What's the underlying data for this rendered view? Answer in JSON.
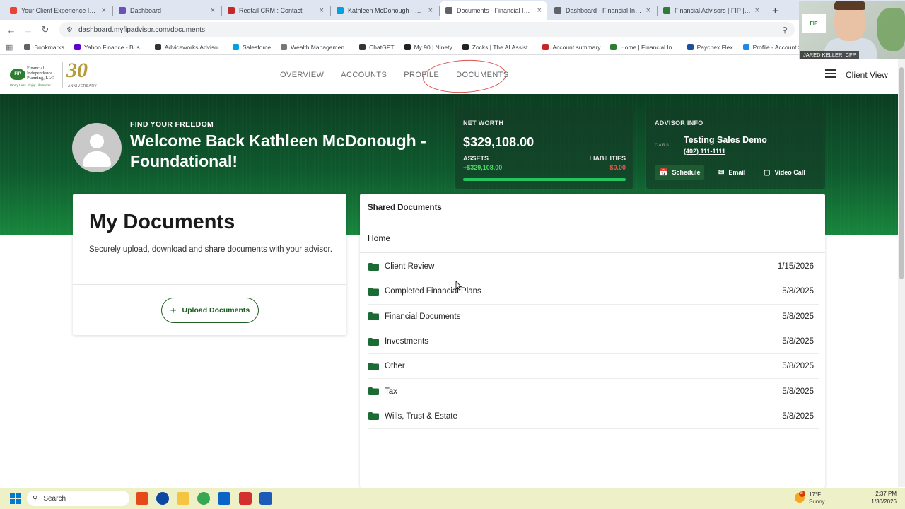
{
  "browser": {
    "tabs": [
      {
        "title": "Your Client Experience Invitat",
        "color": "#ea4335",
        "active": false
      },
      {
        "title": "Dashboard",
        "color": "#6b4fbb",
        "active": false
      },
      {
        "title": "Redtail CRM : Contact",
        "color": "#c62828",
        "active": false
      },
      {
        "title": "Kathleen McDonough - Foun",
        "color": "#00a1e0",
        "active": false
      },
      {
        "title": "Documents - Financial Indep",
        "color": "#5f6368",
        "active": true
      },
      {
        "title": "Dashboard - Financial Indepe",
        "color": "#5f6368",
        "active": false
      },
      {
        "title": "Financial Advisors | FIP | Fina",
        "color": "#2e7d32",
        "active": false
      }
    ],
    "url": "dashboard.myfipadvisor.com/documents",
    "bookmarks": [
      {
        "label": "Bookmarks",
        "color": "#5f6368"
      },
      {
        "label": "Yahoo Finance - Bus...",
        "color": "#6001d2"
      },
      {
        "label": "Adviceworks Adviso...",
        "color": "#333333"
      },
      {
        "label": "Salesforce",
        "color": "#00a1e0"
      },
      {
        "label": "Wealth Managemen...",
        "color": "#777777"
      },
      {
        "label": "ChatGPT",
        "color": "#333333"
      },
      {
        "label": "My 90 | Ninety",
        "color": "#222222"
      },
      {
        "label": "Zocks | The AI Assist...",
        "color": "#222222"
      },
      {
        "label": "Account summary",
        "color": "#c62828"
      },
      {
        "label": "Home | Financial In...",
        "color": "#2e7d32"
      },
      {
        "label": "Paychex Flex",
        "color": "#1e4f9c"
      },
      {
        "label": "Profile - Account Se...",
        "color": "#1e88e5"
      }
    ]
  },
  "header": {
    "logo": {
      "badge": "FIP",
      "name_line1": "Financial",
      "name_line2": "Independence",
      "name_line3": "Planning, LLC",
      "tagline": "Worry Less. Enjoy Life More!",
      "anniversary_number": "30",
      "anniversary_label": "ANNIVERSARY"
    },
    "nav": [
      "OVERVIEW",
      "ACCOUNTS",
      "PROFILE",
      "DOCUMENTS"
    ],
    "active_nav": "DOCUMENTS",
    "client_view_label": "Client View"
  },
  "hero": {
    "eyebrow": "FIND YOUR FREEDOM",
    "welcome": "Welcome Back Kathleen McDonough - Foundational!",
    "net_worth": {
      "label": "NET WORTH",
      "value": "$329,108.00",
      "assets_label": "ASSETS",
      "assets_value": "+$329,108.00",
      "liabilities_label": "LIABILITIES",
      "liabilities_value": "$0.00",
      "assets_share": 1.0
    },
    "advisor": {
      "label": "ADVISOR INFO",
      "logo_text": "CARS",
      "name": "Testing Sales Demo",
      "phone": "(402) 111-1111",
      "schedule_label": "Schedule",
      "email_label": "Email",
      "video_label": "Video Call"
    }
  },
  "my_documents": {
    "title": "My Documents",
    "description": "Securely upload, download and share documents with your advisor.",
    "upload_label": "Upload Documents"
  },
  "shared_documents": {
    "title": "Shared Documents",
    "breadcrumb": "Home",
    "folders": [
      {
        "name": "Client Review",
        "date": "1/15/2026"
      },
      {
        "name": "Completed Financial Plans",
        "date": "5/8/2025"
      },
      {
        "name": "Financial Documents",
        "date": "5/8/2025"
      },
      {
        "name": "Investments",
        "date": "5/8/2025"
      },
      {
        "name": "Other",
        "date": "5/8/2025"
      },
      {
        "name": "Tax",
        "date": "5/8/2025"
      },
      {
        "name": "Wills, Trust & Estate",
        "date": "5/8/2025"
      }
    ],
    "folder_color": "#1b6b35"
  },
  "video_overlay": {
    "name_label": "JARED KELLER, CFP",
    "wall_logo": "FIP"
  },
  "taskbar": {
    "search_placeholder": "Search",
    "weather_badge": "9+",
    "temperature": "17°F",
    "condition": "Sunny",
    "time": "2:37 PM",
    "date": "1/30/2026"
  }
}
